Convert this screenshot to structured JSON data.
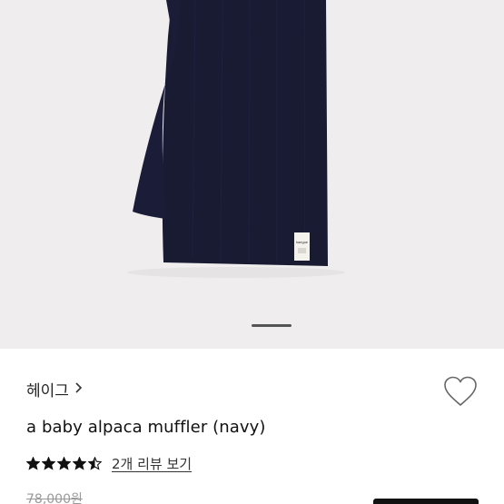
{
  "product": {
    "brand": "헤이그",
    "brand_chevron": "›",
    "title": "a baby alpaca muffler (navy)",
    "rating_value": 4.5,
    "rating_max": 5,
    "review_link": "2개 리뷰 보기",
    "original_price": "78,000원",
    "muffler_color": "#191b33",
    "tag_text": "haegue"
  },
  "icons": {
    "wishlist": "heart-outline-icon",
    "star": "star-icon",
    "brand_chevron": "chevron-right-icon"
  }
}
